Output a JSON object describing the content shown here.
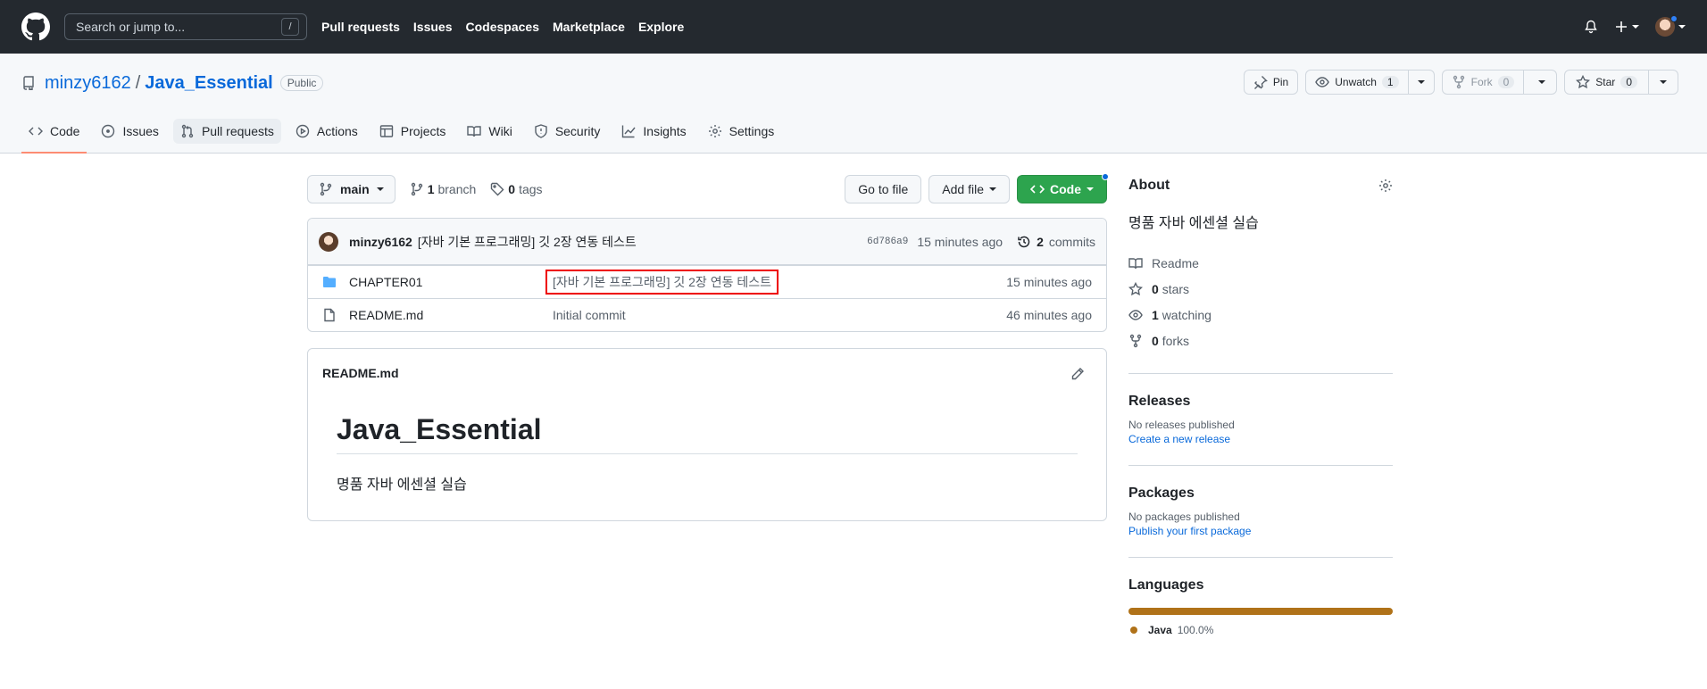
{
  "header": {
    "search_placeholder": "Search or jump to...",
    "search_shortcut": "/",
    "nav": [
      "Pull requests",
      "Issues",
      "Codespaces",
      "Marketplace",
      "Explore"
    ]
  },
  "repo": {
    "owner": "minzy6162",
    "separator": "/",
    "name": "Java_Essential",
    "visibility": "Public",
    "actions": {
      "pin": "Pin",
      "unwatch": "Unwatch",
      "watch_count": "1",
      "fork": "Fork",
      "fork_count": "0",
      "star": "Star",
      "star_count": "0"
    },
    "tabs": [
      "Code",
      "Issues",
      "Pull requests",
      "Actions",
      "Projects",
      "Wiki",
      "Security",
      "Insights",
      "Settings"
    ]
  },
  "toolbar": {
    "branch": "main",
    "branch_count": "1",
    "branch_label": "branch",
    "tag_count": "0",
    "tag_label": "tags",
    "go_to_file": "Go to file",
    "add_file": "Add file",
    "code": "Code"
  },
  "latest_commit": {
    "author": "minzy6162",
    "message": "[자바 기본 프로그래밍] 깃 2장 연동 테스트",
    "sha": "6d786a9",
    "age": "15 minutes ago",
    "commit_count": "2",
    "commit_label": "commits"
  },
  "files": [
    {
      "name": "CHAPTER01",
      "type": "folder",
      "message": "[자바 기본 프로그래밍] 깃 2장 연동 테스트",
      "age": "15 minutes ago"
    },
    {
      "name": "README.md",
      "type": "file",
      "message": "Initial commit",
      "age": "46 minutes ago"
    }
  ],
  "readme": {
    "filename": "README.md",
    "heading": "Java_Essential",
    "body": "명품 자바 에센셜 실습"
  },
  "sidebar": {
    "about_title": "About",
    "description": "명품 자바 에센셜 실습",
    "readme": "Readme",
    "stars_count": "0",
    "stars_label": "stars",
    "watching_count": "1",
    "watching_label": "watching",
    "forks_count": "0",
    "forks_label": "forks",
    "releases_title": "Releases",
    "releases_empty": "No releases published",
    "releases_link": "Create a new release",
    "packages_title": "Packages",
    "packages_empty": "No packages published",
    "packages_link": "Publish your first package",
    "languages_title": "Languages",
    "language_name": "Java",
    "language_pct": "100.0%",
    "language_color": "#b07219"
  }
}
